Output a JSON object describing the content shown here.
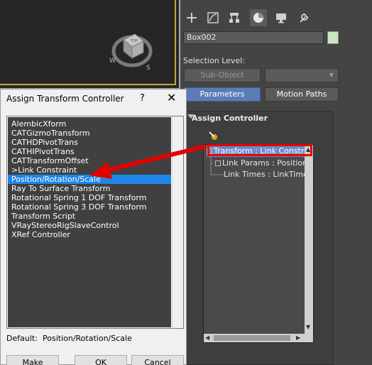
{
  "viewport": {
    "viewcube_top_label": "TOP"
  },
  "panel": {
    "object_name": "Box002",
    "object_color": "#c9e6c0",
    "selection_level_label": "Selection Level:",
    "sub_object_label": "Sub-Object",
    "tabs": [
      {
        "label": "Parameters",
        "active": true
      },
      {
        "label": "Motion Paths",
        "active": false
      }
    ],
    "rollout_title": "Assign Controller",
    "tree": [
      {
        "label": "Transform : Link Constraint",
        "selected": true
      },
      {
        "label": "Link Params : Position/R",
        "selected": false
      },
      {
        "label": "Link Times : LinkTimeCo",
        "selected": false
      }
    ]
  },
  "dialog": {
    "title": "Assign Transform Controller",
    "help_glyph": "?",
    "items": [
      {
        "label": "AlembicXform",
        "selected": false
      },
      {
        "label": "CATGizmoTransform",
        "selected": false
      },
      {
        "label": "CATHDPivotTrans",
        "selected": false
      },
      {
        "label": "CATHIPivotTrans",
        "selected": false
      },
      {
        "label": "CATTransformOffset",
        "selected": false
      },
      {
        "label": ">Link Constraint",
        "selected": false
      },
      {
        "label": "Position/Rotation/Scale",
        "selected": true
      },
      {
        "label": "Ray To Surface Transform",
        "selected": false
      },
      {
        "label": "Rotational Spring 1 DOF Transform",
        "selected": false
      },
      {
        "label": "Rotational Spring 3 DOF Transform",
        "selected": false
      },
      {
        "label": "Transform Script",
        "selected": false
      },
      {
        "label": "VRayStereoRigSlaveControl",
        "selected": false
      },
      {
        "label": "XRef Controller",
        "selected": false
      }
    ],
    "default_label": "Default:",
    "default_value": "Position/Rotation/Scale",
    "buttons": {
      "make_default": "Make Default",
      "ok": "OK",
      "cancel": "Cancel"
    }
  },
  "colors": {
    "selection_blue": "#1e86e6",
    "annotation_red": "#e50000",
    "active_tab": "#5b7db6"
  },
  "icons": [
    "plus-icon",
    "modify-curve-icon",
    "hierarchy-icon",
    "motion-icon",
    "display-icon",
    "utilities-wrench-icon",
    "assign-controller-icon"
  ]
}
